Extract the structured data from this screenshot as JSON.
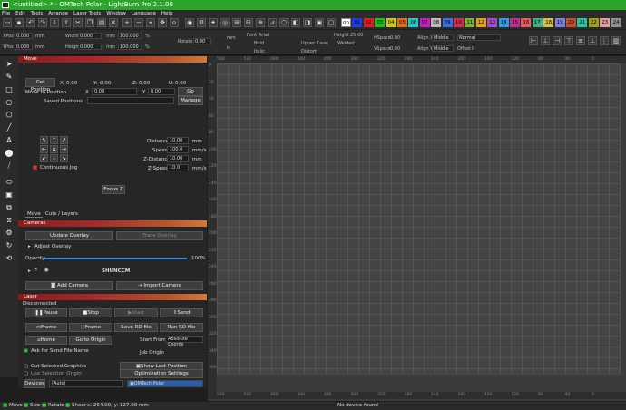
{
  "window": {
    "title": "<untitled> * - OMTech Polar - LightBurn Pro 2.1.00"
  },
  "menu": [
    "File",
    "Edit",
    "Tools",
    "Arrange",
    "Laser Tools",
    "Window",
    "Language",
    "Help"
  ],
  "layers": [
    {
      "label": "00",
      "color": "#ffffff"
    },
    {
      "label": "01",
      "color": "#1a3ee0"
    },
    {
      "label": "02",
      "color": "#e02020"
    },
    {
      "label": "03",
      "color": "#20c020"
    },
    {
      "label": "04",
      "color": "#c8c820"
    },
    {
      "label": "05",
      "color": "#e07020"
    },
    {
      "label": "06",
      "color": "#20c8c8"
    },
    {
      "label": "07",
      "color": "#c020c0"
    },
    {
      "label": "08",
      "color": "#bbbbbb"
    },
    {
      "label": "09",
      "color": "#3a70e0"
    },
    {
      "label": "10",
      "color": "#d03050"
    },
    {
      "label": "11",
      "color": "#7ab040"
    },
    {
      "label": "12",
      "color": "#e0a020"
    },
    {
      "label": "13",
      "color": "#a050c0"
    },
    {
      "label": "14",
      "color": "#30a0e0"
    },
    {
      "label": "15",
      "color": "#c03090"
    },
    {
      "label": "16",
      "color": "#e06060"
    },
    {
      "label": "17",
      "color": "#40b080"
    },
    {
      "label": "18",
      "color": "#d0c050"
    },
    {
      "label": "19",
      "color": "#8080e0"
    },
    {
      "label": "20",
      "color": "#c05030"
    },
    {
      "label": "21",
      "color": "#30c0a0"
    },
    {
      "label": "22",
      "color": "#a0a020"
    },
    {
      "label": "23",
      "color": "#e0a0a0"
    },
    {
      "label": "24",
      "color": "#909090"
    }
  ],
  "props": {
    "xpos_label": "XPos",
    "xpos": "0.000",
    "ypos_label": "YPos",
    "ypos": "0.000",
    "width_label": "Width",
    "width": "0.000",
    "height_label": "Height",
    "height": "0.000",
    "unit": "mm",
    "pct1": "100.000",
    "pct2": "100.000",
    "pct_sym": "%",
    "rotate_label": "Rotate",
    "rotate": "0.00",
    "mm": "mm",
    "in": "in",
    "font_label": "Font",
    "font": "Arial",
    "font_height_label": "Height",
    "font_height": "25.00",
    "bold": "Bold",
    "italic": "Italic",
    "upper": "Upper Case",
    "distort": "Distort",
    "welded": "Welded",
    "hspace_label": "HSpace",
    "hspace": "0.00",
    "vspace_label": "VSpace",
    "vspace": "0.00",
    "alignx_label": "Align X",
    "alignx": "Middle",
    "aligny_label": "Align Y",
    "aligny": "Middle",
    "normal": "Normal",
    "offset_label": "Offset",
    "offset": "0"
  },
  "move": {
    "header": "Move",
    "get_position": "Get Position",
    "x_label": "X:",
    "x_val": "0.00",
    "y_label": "Y:",
    "y_val": "0.00",
    "z_label": "Z:",
    "z_val": "0.00",
    "u_label": "U:",
    "u_val": "0.00",
    "move_to_position": "Move to Position",
    "mx_label": "X",
    "mx": "0.00",
    "my_label": "Y",
    "my": "0.00",
    "go": "Go",
    "saved_positions": "Saved Positions",
    "manage": "Manage",
    "distance_label": "Distance",
    "distance": "10.00",
    "speed_label": "Speed",
    "speed": "100.0",
    "zdistance_label": "Z-Distance",
    "zdistance": "10.00",
    "zspeed_label": "Z-Speed",
    "zspeed": "10.0",
    "mm": "mm",
    "mms": "mm/s",
    "continuous_jog": "Continuous Jog",
    "focus_z": "Focus Z"
  },
  "tabs": [
    "Move",
    "Cuts / Layers"
  ],
  "cameras": {
    "header": "Cameras",
    "update_overlay": "Update Overlay",
    "trace_overlay": "Trace Overlay",
    "adjust_overlay": "Adjust Overlay",
    "opacity_label": "Opacity:",
    "opacity": "100%",
    "camera_name": "SHUNCCM",
    "add_camera": "Add Camera",
    "import_camera": "Import Camera",
    "opacity_value": 1.0
  },
  "laser": {
    "header": "Laser",
    "state": "Disconnected",
    "pause": "Pause",
    "stop": "Stop",
    "start": "Start",
    "send": "Send",
    "frame1": "Frame",
    "frame2": "Frame",
    "save_rd": "Save RD file",
    "run_rd": "Run RD file",
    "home": "Home",
    "go_to_origin": "Go to Origin",
    "start_from_label": "Start From:",
    "start_from": "Absolute Coords",
    "ask_send": "Ask for Send File Name",
    "job_origin": "Job Origin",
    "cut_selected": "Cut Selected Graphics",
    "use_selection": "Use Selection Origin",
    "show_last": "Show Last Position",
    "optimization": "Optimization Settings",
    "devices": "Devices",
    "auto": "(Auto)",
    "device_name": "OMTech Polar"
  },
  "ruler_top": [
    "560",
    "520",
    "480",
    "440",
    "400",
    "360",
    "320",
    "280",
    "240",
    "200",
    "160",
    "120",
    "80",
    "40",
    "0"
  ],
  "ruler_bottom": [
    "560",
    "520",
    "480",
    "440",
    "400",
    "360",
    "320",
    "280",
    "240",
    "200",
    "160",
    "120",
    "80",
    "40",
    "0"
  ],
  "ruler_left": [
    "0",
    "20",
    "40",
    "60",
    "80",
    "100",
    "120",
    "140",
    "160",
    "180",
    "200",
    "220",
    "240",
    "260",
    "280",
    "300",
    "320",
    "340",
    "360"
  ],
  "status": {
    "move": "Move",
    "size": "Size",
    "rotate": "Rotate",
    "shear": "Shear",
    "coords": "x: 264.00, y: 127.00 mm",
    "device": "No device found"
  }
}
